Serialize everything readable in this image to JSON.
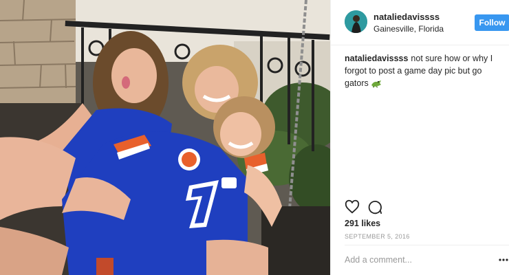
{
  "post": {
    "image_alt": "Three friends in Florida Gators jerseys posing on a porch swing",
    "header": {
      "avatar_icon": "profile-avatar",
      "username": "nataliedavissss",
      "location": "Gainesville, Florida",
      "follow_label": "Follow"
    },
    "caption": {
      "username": "nataliedavissss",
      "text": "not sure how or why I forgot to post a game day pic but go gators",
      "emoji_icon": "crocodile-emoji"
    },
    "actions": {
      "like_icon": "heart-icon",
      "comment_icon": "comment-icon"
    },
    "likes": "291 likes",
    "date": "SEPTEMBER 5, 2016",
    "comment_box": {
      "placeholder": "Add a comment...",
      "more_icon": "more-options-icon"
    }
  },
  "colors": {
    "follow_button": "#3897f0",
    "text": "#262626",
    "muted": "#999999",
    "divider": "#efefef",
    "jersey_blue": "#1f3fbf",
    "jersey_orange": "#e8602c"
  }
}
